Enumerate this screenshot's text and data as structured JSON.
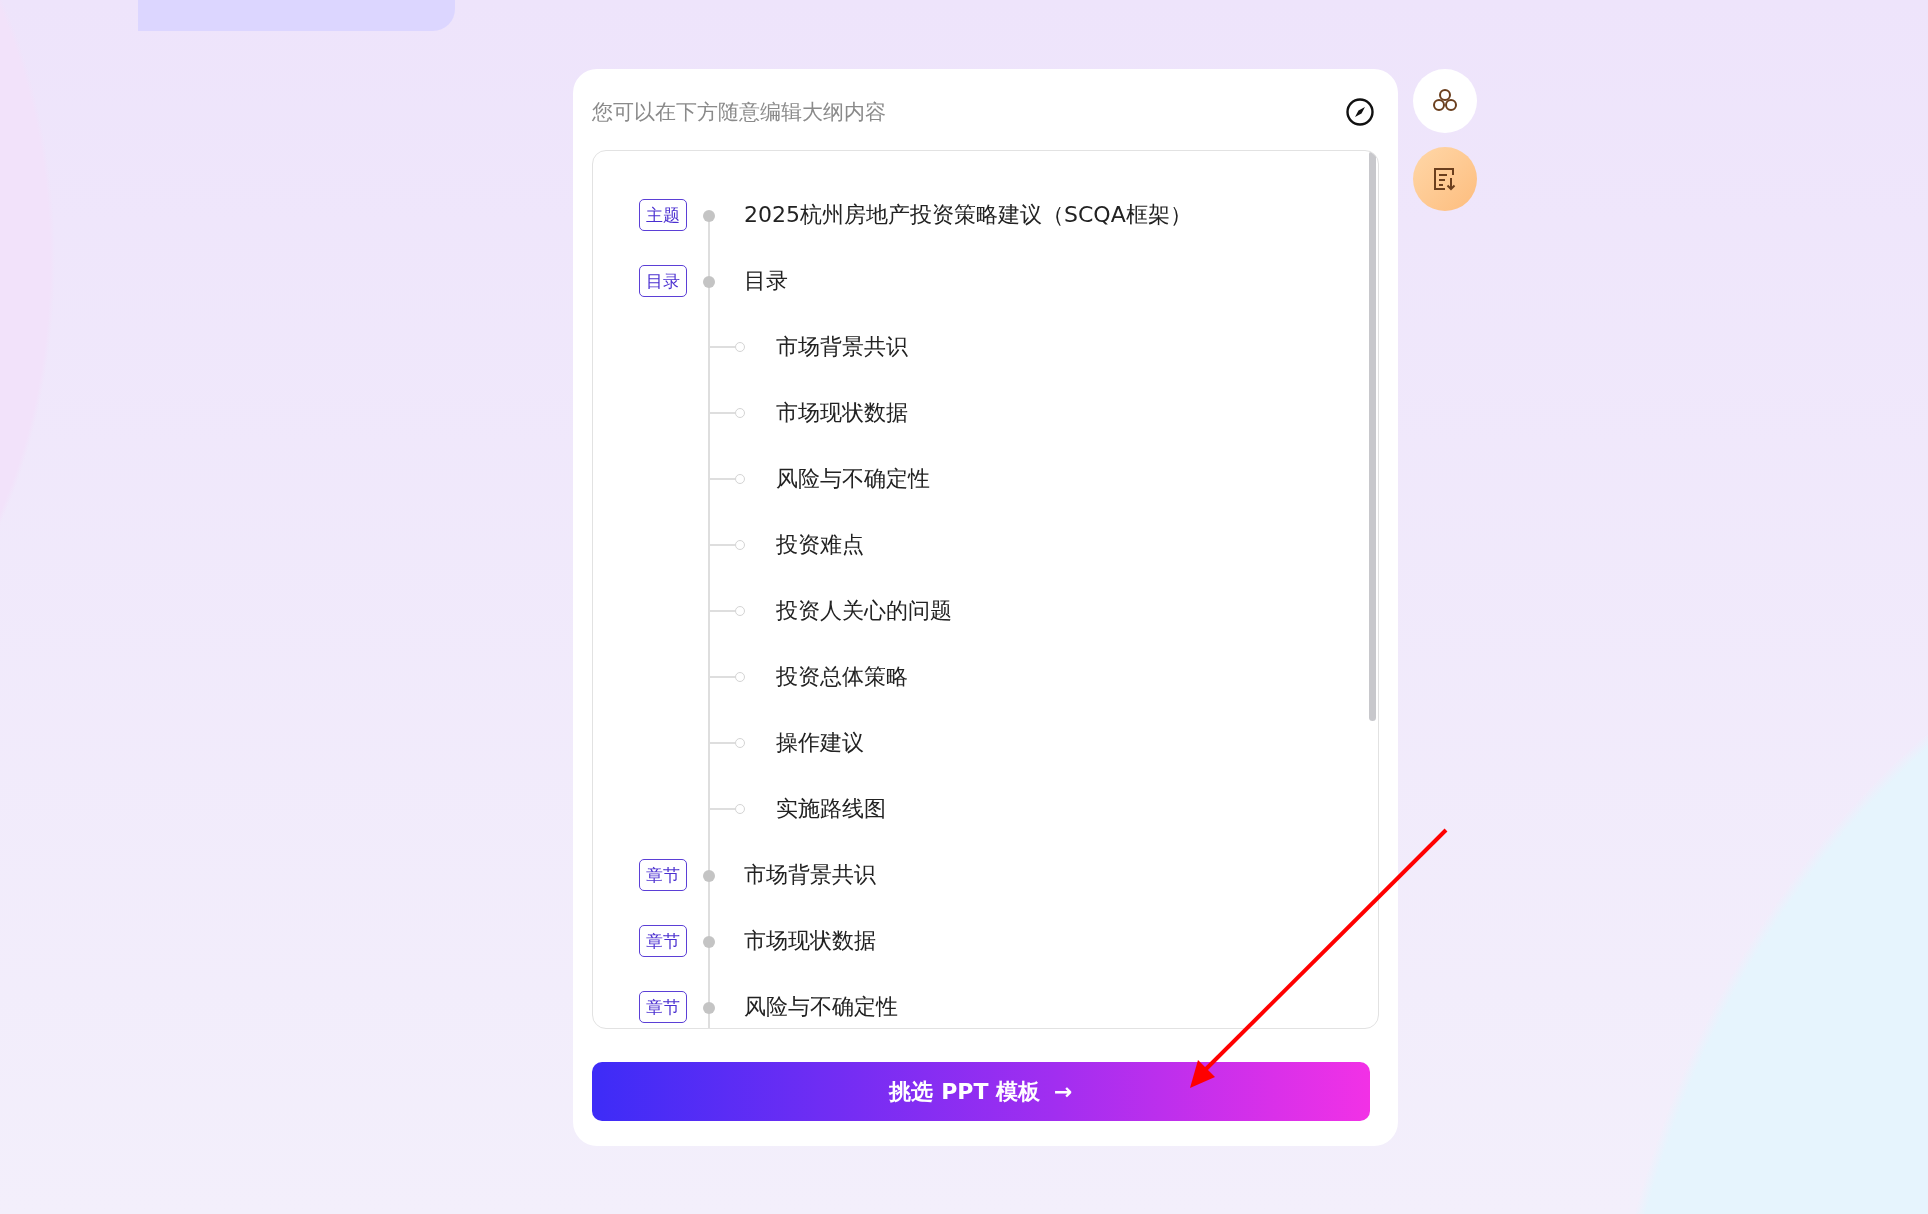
{
  "editor": {
    "hint": "您可以在下方随意编辑大纲内容",
    "outline": [
      {
        "tag": "主题",
        "title": "2025杭州房地产投资策略建议（SCQA框架）"
      },
      {
        "tag": "目录",
        "title": "目录",
        "children": [
          {
            "title": "市场背景共识"
          },
          {
            "title": "市场现状数据"
          },
          {
            "title": "风险与不确定性"
          },
          {
            "title": "投资难点"
          },
          {
            "title": "投资人关心的问题"
          },
          {
            "title": "投资总体策略"
          },
          {
            "title": "操作建议"
          },
          {
            "title": "实施路线图"
          }
        ]
      },
      {
        "tag": "章节",
        "title": "市场背景共识"
      },
      {
        "tag": "章节",
        "title": "市场现状数据"
      },
      {
        "tag": "章节",
        "title": "风险与不确定性"
      }
    ],
    "button": {
      "label": "挑选 PPT 模板",
      "arrow": "→"
    }
  }
}
